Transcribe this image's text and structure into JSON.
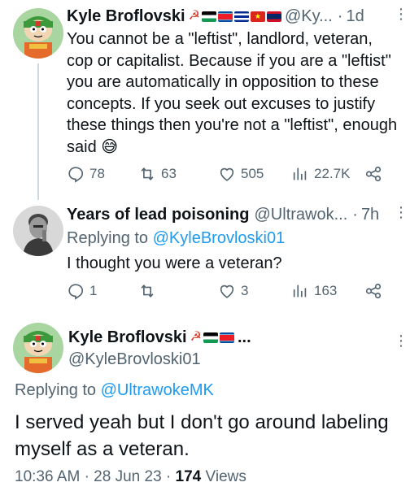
{
  "tweets": [
    {
      "name": "Kyle Broflovski",
      "handle": "@Ky...",
      "time": "1d",
      "text": "You cannot be a \"leftist\", landlord, veteran, cop or capitalist. Because if you are a \"leftist\" you are automatically in opposition to these concepts. If you seek out excuses to justify these things then you're not a \"leftist\", enough said 😅",
      "replies": "78",
      "retweets": "63",
      "likes": "505",
      "views": "22.7K"
    },
    {
      "name": "Years of lead poisoning",
      "handle": "@Ultrawok...",
      "time": "7h",
      "replying_label": "Replying to",
      "replying_to": "@KyleBrovloski01",
      "text": "I thought you were a veteran?",
      "replies": "1",
      "retweets": "",
      "likes": "3",
      "views": "163"
    }
  ],
  "main": {
    "name": "Kyle Broflovski",
    "ellipsis": "...",
    "handle": "@KyleBrovloski01",
    "replying_label": "Replying to",
    "replying_to": "@UltrawokeMK",
    "text": "I served yeah but I don't go around labeling myself as a veteran.",
    "time": "10:36 AM",
    "date": "28 Jun 23",
    "views_count": "174",
    "views_label": "Views"
  },
  "separator": "·",
  "colors": {
    "text": "#0f1419",
    "muted": "#536471",
    "link": "#1d9bf0",
    "thread_line": "#cfd9de"
  },
  "icons": [
    "reply-icon",
    "retweet-icon",
    "like-icon",
    "views-icon",
    "share-icon",
    "more-icon"
  ]
}
